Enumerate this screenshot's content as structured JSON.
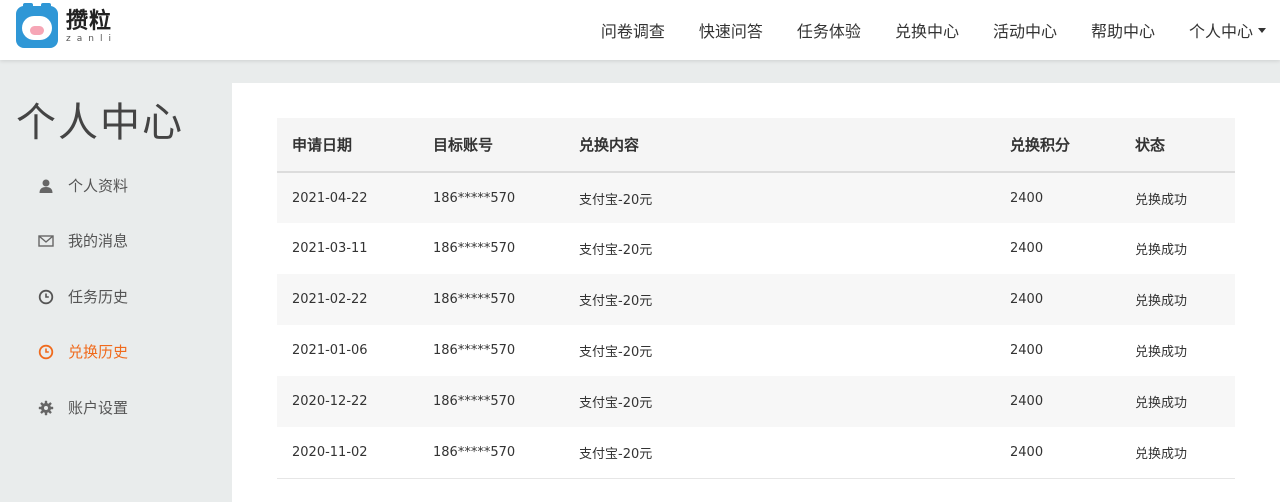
{
  "brand": {
    "name_cn": "攒粒",
    "name_en": "zanli",
    "accent": "#2f97d6"
  },
  "nav": {
    "items": [
      "问卷调查",
      "快速问答",
      "任务体验",
      "兑换中心",
      "活动中心",
      "帮助中心"
    ],
    "user_menu": "个人中心"
  },
  "sidebar": {
    "title": "个人中心",
    "active_color": "#f06a1c",
    "items": [
      {
        "label": "个人资料",
        "icon": "user-icon"
      },
      {
        "label": "我的消息",
        "icon": "envelope-icon"
      },
      {
        "label": "任务历史",
        "icon": "clock-icon"
      },
      {
        "label": "兑换历史",
        "icon": "clock-icon",
        "active": true
      },
      {
        "label": "账户设置",
        "icon": "gear-icon"
      }
    ]
  },
  "table": {
    "headers": [
      "申请日期",
      "目标账号",
      "兑换内容",
      "兑换积分",
      "状态"
    ],
    "rows": [
      [
        "2021-04-22",
        "186*****570",
        "支付宝-20元",
        "2400",
        "兑换成功"
      ],
      [
        "2021-03-11",
        "186*****570",
        "支付宝-20元",
        "2400",
        "兑换成功"
      ],
      [
        "2021-02-22",
        "186*****570",
        "支付宝-20元",
        "2400",
        "兑换成功"
      ],
      [
        "2021-01-06",
        "186*****570",
        "支付宝-20元",
        "2400",
        "兑换成功"
      ],
      [
        "2020-12-22",
        "186*****570",
        "支付宝-20元",
        "2400",
        "兑换成功"
      ],
      [
        "2020-11-02",
        "186*****570",
        "支付宝-20元",
        "2400",
        "兑换成功"
      ]
    ]
  }
}
